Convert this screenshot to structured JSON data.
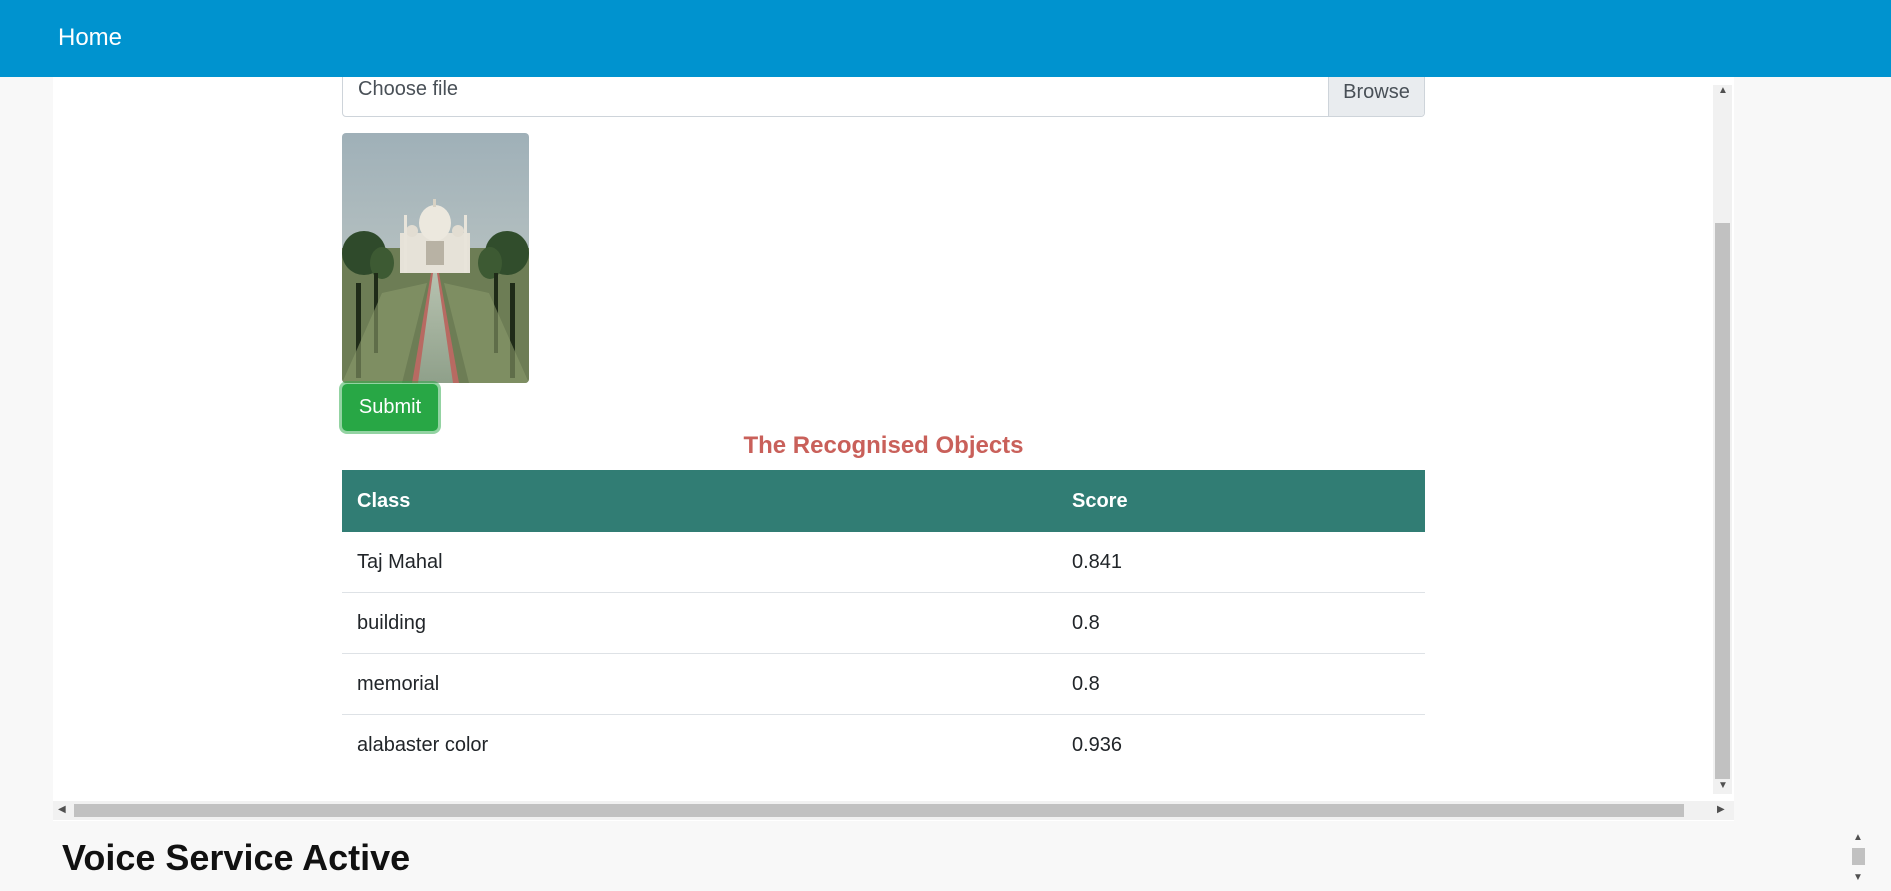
{
  "navbar": {
    "home_label": "Home"
  },
  "upload": {
    "placeholder": "Choose file",
    "browse_label": "Browse",
    "submit_label": "Submit"
  },
  "results": {
    "title": "The Recognised Objects",
    "columns": [
      "Class",
      "Score"
    ],
    "rows": [
      {
        "class": "Taj Mahal",
        "score": "0.841"
      },
      {
        "class": "building",
        "score": "0.8"
      },
      {
        "class": "memorial",
        "score": "0.8"
      },
      {
        "class": "alabaster color",
        "score": "0.936"
      }
    ]
  },
  "voice": {
    "status": "Voice Service Active"
  },
  "colors": {
    "navbar": "#0093cf",
    "submit": "#28a745",
    "table_header": "#317d74",
    "section_title": "#c9605a"
  },
  "icons": {
    "scroll_up": "triangle-up",
    "scroll_down": "triangle-down",
    "scroll_left": "triangle-left",
    "scroll_right": "triangle-right"
  }
}
